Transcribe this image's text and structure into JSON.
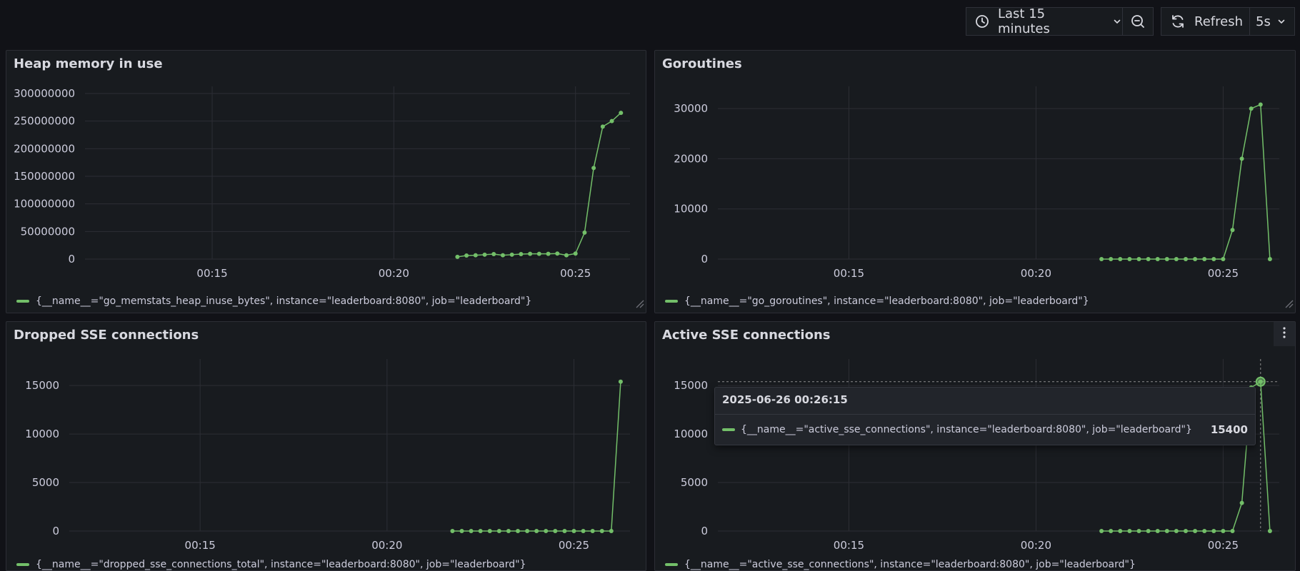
{
  "toolbar": {
    "time_range_label": "Last 15 minutes",
    "refresh_label": "Refresh",
    "refresh_interval": "5s"
  },
  "colors": {
    "series": "#73bf69",
    "grid": "#2c2e35",
    "background": "#181b1f"
  },
  "panels": [
    {
      "title": "Heap memory in use",
      "legend": "{__name__=\"go_memstats_heap_inuse_bytes\", instance=\"leaderboard:8080\", job=\"leaderboard\"}"
    },
    {
      "title": "Goroutines",
      "legend": "{__name__=\"go_goroutines\", instance=\"leaderboard:8080\", job=\"leaderboard\"}"
    },
    {
      "title": "Dropped SSE connections",
      "legend": "{__name__=\"dropped_sse_connections_total\", instance=\"leaderboard:8080\", job=\"leaderboard\"}"
    },
    {
      "title": "Active SSE connections",
      "legend": "{__name__=\"active_sse_connections\", instance=\"leaderboard:8080\", job=\"leaderboard\"}"
    }
  ],
  "tooltip": {
    "time": "2025-06-26 00:26:15",
    "label": "{__name__=\"active_sse_connections\", instance=\"leaderboard:8080\", job=\"leaderboard\"}",
    "value": "15400"
  },
  "chart_data": [
    {
      "type": "line",
      "title": "Heap memory in use",
      "x_tick_labels": [
        "00:15",
        "00:20",
        "00:25"
      ],
      "x_tick_minutes": [
        15,
        20,
        25
      ],
      "xlim_minutes": [
        11.5,
        26.5
      ],
      "y_tick_labels": [
        "300000000",
        "250000000",
        "200000000",
        "150000000",
        "100000000",
        "50000000",
        "0"
      ],
      "ylim": [
        0,
        300000000
      ],
      "series": [
        {
          "x_minutes": [
            21.75,
            22,
            22.25,
            22.5,
            22.75,
            23,
            23.25,
            23.5,
            23.75,
            24,
            24.25,
            24.5,
            24.75,
            25,
            25.25,
            25.5,
            25.75,
            26,
            26.25
          ],
          "values": [
            4000000,
            6500000,
            7000000,
            8000000,
            9000000,
            7000000,
            8000000,
            9000000,
            9500000,
            9500000,
            9500000,
            10000000,
            7000000,
            10000000,
            48000000,
            165000000,
            240000000,
            250000000,
            265000000
          ]
        }
      ]
    },
    {
      "type": "line",
      "title": "Goroutines",
      "x_tick_labels": [
        "00:15",
        "00:20",
        "00:25"
      ],
      "x_tick_minutes": [
        15,
        20,
        25
      ],
      "xlim_minutes": [
        11.5,
        26.5
      ],
      "y_tick_labels": [
        "30000",
        "20000",
        "10000",
        "0"
      ],
      "ylim": [
        0,
        33000
      ],
      "series": [
        {
          "x_minutes": [
            21.75,
            22,
            22.25,
            22.5,
            22.75,
            23,
            23.25,
            23.5,
            23.75,
            24,
            24.25,
            24.5,
            24.75,
            25,
            25.25,
            25.5,
            25.75,
            26,
            26.25
          ],
          "values": [
            0,
            0,
            0,
            0,
            0,
            0,
            0,
            0,
            0,
            0,
            0,
            0,
            0,
            0,
            5800,
            20000,
            30000,
            30800,
            0
          ]
        }
      ]
    },
    {
      "type": "line",
      "title": "Dropped SSE connections",
      "x_tick_labels": [
        "00:15",
        "00:20",
        "00:25"
      ],
      "x_tick_minutes": [
        15,
        20,
        25
      ],
      "xlim_minutes": [
        11.5,
        26.5
      ],
      "y_tick_labels": [
        "15000",
        "10000",
        "5000",
        "0"
      ],
      "ylim": [
        0,
        17000
      ],
      "series": [
        {
          "x_minutes": [
            21.75,
            22,
            22.25,
            22.5,
            22.75,
            23,
            23.25,
            23.5,
            23.75,
            24,
            24.25,
            24.5,
            24.75,
            25,
            25.25,
            25.5,
            25.75,
            26,
            26.25
          ],
          "values": [
            0,
            0,
            0,
            0,
            0,
            0,
            0,
            0,
            0,
            0,
            0,
            0,
            0,
            0,
            0,
            0,
            0,
            0,
            15400
          ]
        }
      ]
    },
    {
      "type": "line",
      "title": "Active SSE connections",
      "x_tick_labels": [
        "00:15",
        "00:20",
        "00:25"
      ],
      "x_tick_minutes": [
        15,
        20,
        25
      ],
      "xlim_minutes": [
        11.5,
        26.5
      ],
      "y_tick_labels": [
        "15000",
        "10000",
        "5000",
        "0"
      ],
      "ylim": [
        0,
        17000
      ],
      "series": [
        {
          "x_minutes": [
            21.75,
            22,
            22.25,
            22.5,
            22.75,
            23,
            23.25,
            23.5,
            23.75,
            24,
            24.25,
            24.5,
            24.75,
            25,
            25.25,
            25.5,
            25.75,
            26,
            26.25
          ],
          "values": [
            0,
            0,
            0,
            0,
            0,
            0,
            0,
            0,
            0,
            0,
            0,
            0,
            0,
            0,
            0,
            2900,
            14800,
            15400,
            0
          ]
        }
      ],
      "highlight_x_minutes": 26
    }
  ]
}
